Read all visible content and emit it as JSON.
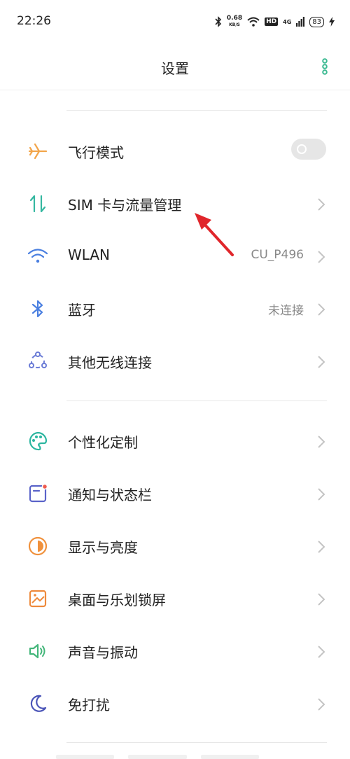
{
  "status": {
    "time": "22:26",
    "speed_value": "0.68",
    "speed_unit": "KB/S",
    "hd": "HD",
    "signal": "4G",
    "battery": "83"
  },
  "header": {
    "title": "设置"
  },
  "rows": {
    "airplane": {
      "label": "飞行模式",
      "toggle_on": false
    },
    "sim": {
      "label": "SIM 卡与流量管理"
    },
    "wlan": {
      "label": "WLAN",
      "value": "CU_P496"
    },
    "bluetooth": {
      "label": "蓝牙",
      "value": "未连接"
    },
    "wireless": {
      "label": "其他无线连接"
    },
    "personalize": {
      "label": "个性化定制"
    },
    "notify": {
      "label": "通知与状态栏"
    },
    "display": {
      "label": "显示与亮度"
    },
    "desktop": {
      "label": "桌面与乐划锁屏"
    },
    "sound": {
      "label": "声音与振动"
    },
    "dnd": {
      "label": "免打扰"
    }
  },
  "colors": {
    "accent": "#3cba92",
    "airplane": "#f2a54a",
    "sim": "#34b7a0",
    "wlan": "#4a7fe0",
    "bluetooth": "#4a7fe0",
    "wireless": "#6a7bd6",
    "personalize": "#2cb6a0",
    "notify": "#5a63c9",
    "display": "#f0913c",
    "desktop": "#ee8a3c",
    "sound": "#43b67a",
    "dnd": "#4b55b8",
    "annotation_arrow": "#e0262b"
  }
}
